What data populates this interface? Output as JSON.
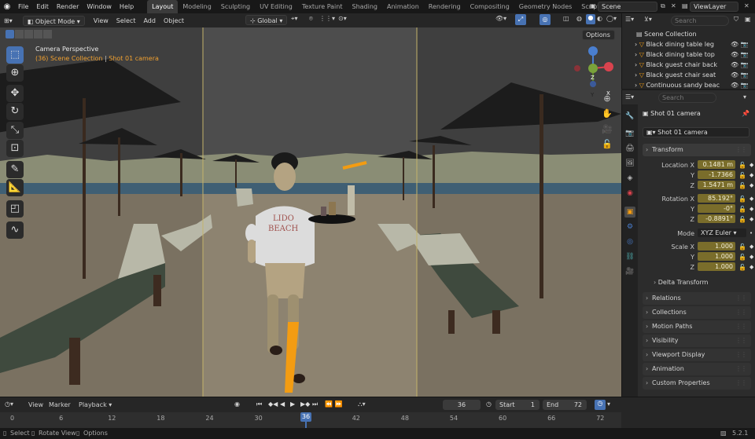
{
  "menubar": {
    "items": [
      "File",
      "Edit",
      "Render",
      "Window",
      "Help"
    ],
    "workspaces": [
      "Layout",
      "Modeling",
      "Sculpting",
      "UV Editing",
      "Texture Paint",
      "Shading",
      "Animation",
      "Rendering",
      "Compositing",
      "Geometry Nodes",
      "Scripting"
    ],
    "active_workspace": "Layout",
    "add_tab": "+",
    "scene": "Scene",
    "view_layer": "ViewLayer"
  },
  "viewport_header": {
    "mode": "Object Mode",
    "menus": [
      "View",
      "Select",
      "Add",
      "Object"
    ],
    "orientation": "Global",
    "options": "Options"
  },
  "viewport": {
    "perspective": "Camera Perspective",
    "collection_frame": "(36) Scene Collection",
    "separator": "|",
    "active_object": "Shot 01 camera",
    "shirt_text_1": "LIDO",
    "shirt_text_2": "BEACH",
    "gizmo": {
      "x": "X",
      "y": "Y",
      "z": "Z"
    }
  },
  "outliner": {
    "search_placeholder": "Search",
    "root": "Scene Collection",
    "items": [
      "Black dining table leg",
      "Black dining table top",
      "Black guest chair back",
      "Black guest chair seat",
      "Continuous sandy beac"
    ]
  },
  "properties": {
    "search_placeholder": "Search",
    "context_object": "Shot 01 camera",
    "object_name": "Shot 01 camera",
    "transform": {
      "title": "Transform",
      "location_label": "Location X",
      "location": [
        "0.1481 m",
        "-1.7366",
        "1.5471 m"
      ],
      "rotation_label": "Rotation X",
      "rotation": [
        "85.192°",
        "-0°",
        "-0.8891°"
      ],
      "mode_label": "Mode",
      "mode": "XYZ Euler",
      "scale_label": "Scale X",
      "scale": [
        "1.000",
        "1.000",
        "1.000"
      ],
      "axis_y": "Y",
      "axis_z": "Z",
      "delta": "Delta Transform"
    },
    "panels": [
      "Relations",
      "Collections",
      "Motion Paths",
      "Visibility",
      "Viewport Display",
      "Animation",
      "Custom Properties"
    ]
  },
  "timeline": {
    "menus": [
      "View",
      "Marker",
      "Playback"
    ],
    "current_frame": "36",
    "start_label": "Start",
    "start": "1",
    "end_label": "End",
    "end": "72",
    "ticks": [
      "0",
      "6",
      "12",
      "18",
      "24",
      "30",
      "36",
      "42",
      "48",
      "54",
      "60",
      "66",
      "72"
    ],
    "playhead": "36"
  },
  "statusbar": {
    "items": [
      "Select",
      "Rotate View",
      "Options"
    ],
    "version": "5.2.1"
  },
  "colors": {
    "accent": "#4772b3",
    "field_animated": "#7a6d2b",
    "orange": "#f39c12"
  }
}
